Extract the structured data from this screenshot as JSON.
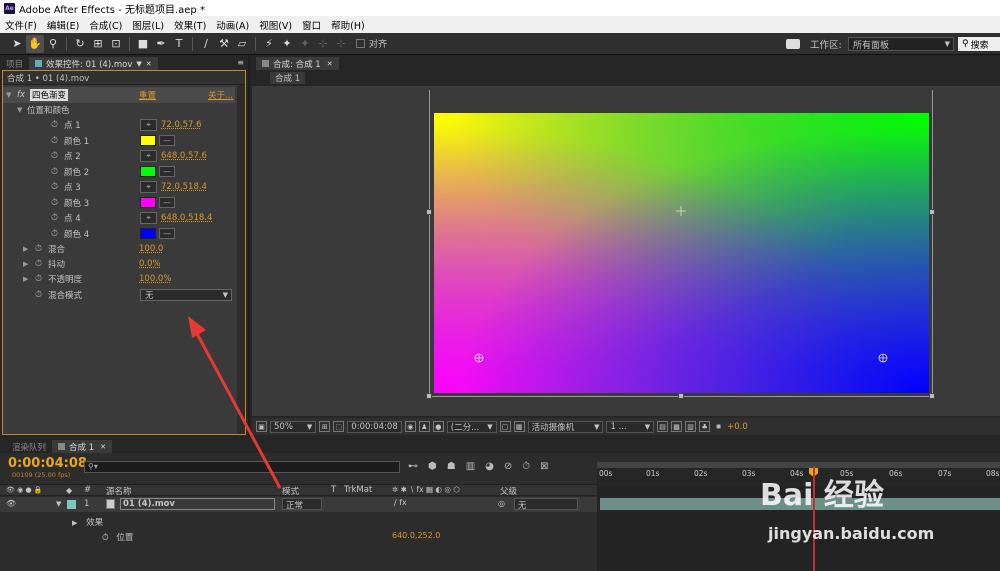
{
  "window": {
    "title": "Adobe After Effects - 无标题项目.aep *",
    "app_icon": "Ae"
  },
  "menu": [
    "文件(F)",
    "编辑(E)",
    "合成(C)",
    "图层(L)",
    "效果(T)",
    "动画(A)",
    "视图(V)",
    "窗口",
    "帮助(H)"
  ],
  "toolbar": {
    "snap_label": "对齐",
    "workspace_label": "工作区:",
    "workspace_value": "所有面板",
    "search_placeholder": "搜索"
  },
  "left_tabs": {
    "project": "项目",
    "effect_controls": "效果控件: 01 (4).mov"
  },
  "fx": {
    "header": "合成 1 • 01 (4).mov",
    "effect_name": "四色渐变",
    "reset": "重置",
    "about": "关于...",
    "group": "位置和颜色",
    "p1": "点 1",
    "p1v": "72.0,57.6",
    "c1": "颜色 1",
    "p2": "点 2",
    "p2v": "648.0,57.6",
    "c2": "颜色 2",
    "p3": "点 3",
    "p3v": "72.0,518.4",
    "c3": "颜色 3",
    "p4": "点 4",
    "p4v": "648.0,518.4",
    "c4": "颜色 4",
    "blend": "混合",
    "blendv": "100.0",
    "jitter": "抖动",
    "jitterv": "0.0%",
    "opacity": "不透明度",
    "opacityv": "100.0%",
    "mode": "混合模式",
    "modev": "无"
  },
  "colors": {
    "c1": "#ffff00",
    "c2": "#00ff00",
    "c3": "#ff00ff",
    "c4": "#0000ff",
    "accent": "#e8a623",
    "playhead": "#c03030"
  },
  "comp": {
    "tab": "合成: 合成 1",
    "sub_tab": "合成 1"
  },
  "footer": {
    "zoom": "50%",
    "timecode": "0:00:04:08",
    "resolution": "(二分...",
    "camera": "活动摄像机",
    "views": "1 ...",
    "exposure": "+0.0"
  },
  "timeline": {
    "tab_render": "渲染队列",
    "tab_comp": "合成 1",
    "timecode": "0:00:04:08",
    "fps": "00109 (25.00 fps)",
    "col_source": "源名称",
    "col_mode": "模式",
    "col_t": "T",
    "col_trkmat": "TrkMat",
    "col_parent": "父级",
    "layer_num": "1",
    "layer_name": "01 (4).mov",
    "layer_mode": "正常",
    "layer_parent": "无",
    "sub_effects": "效果",
    "sub_position": "位置",
    "sub_position_val": "640.0,252.0",
    "ruler": [
      "00s",
      "01s",
      "02s",
      "03s",
      "04s",
      "05s",
      "06s",
      "07s",
      "08s"
    ]
  },
  "watermark": {
    "brand": "Bai 经验",
    "url": "jingyan.baidu.com"
  }
}
